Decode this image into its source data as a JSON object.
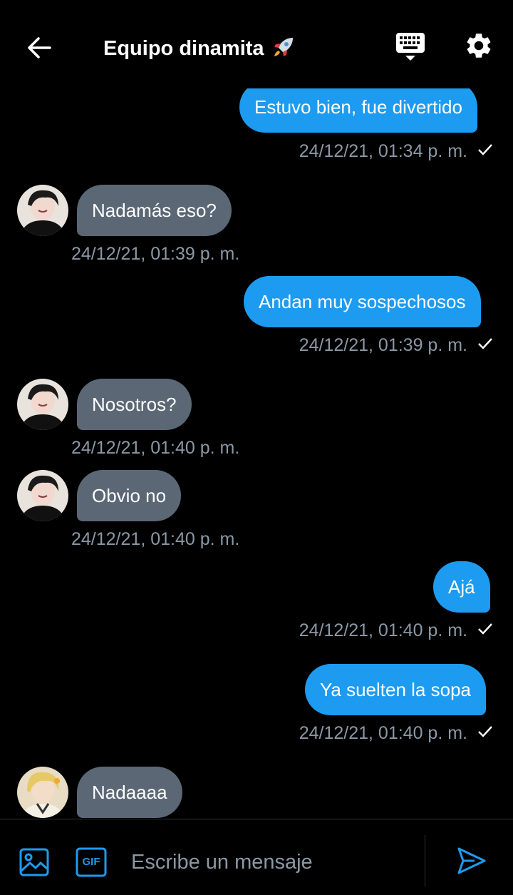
{
  "header": {
    "title": "Equipo dinamita",
    "title_emoji_icon": "rocket-icon",
    "back_icon": "arrow-left-icon",
    "keyboard_icon": "keyboard-icon",
    "settings_icon": "gear-icon"
  },
  "messages": [
    {
      "direction": "out",
      "text": "Estuvo bien, fue divertido",
      "time": "24/12/21, 01:34 p. m.",
      "read": true
    },
    {
      "direction": "in",
      "text": "Nadamás eso?",
      "time": "24/12/21, 01:39 p. m.",
      "avatar": "avatar-dark-hair"
    },
    {
      "direction": "out",
      "text": "Andan muy sospechosos",
      "time": "24/12/21, 01:39 p. m.",
      "read": true
    },
    {
      "direction": "in",
      "text": "Nosotros?",
      "time": "24/12/21, 01:40 p. m.",
      "avatar": "avatar-dark-hair"
    },
    {
      "direction": "in",
      "text": "Obvio no",
      "time": "24/12/21, 01:40 p. m.",
      "avatar": "avatar-dark-hair"
    },
    {
      "direction": "out",
      "text": "Ajá",
      "time": "24/12/21, 01:40 p. m.",
      "read": true
    },
    {
      "direction": "out",
      "text": "Ya suelten la sopa",
      "time": "24/12/21, 01:40 p. m.",
      "read": true
    },
    {
      "direction": "in",
      "text": "Nadaaaa",
      "avatar": "avatar-blonde-hair"
    }
  ],
  "composer": {
    "placeholder": "Escribe un mensaje",
    "image_icon": "image-icon",
    "gif_label": "GIF",
    "send_icon": "send-icon"
  },
  "colors": {
    "background": "#000000",
    "outgoing_bubble": "#1d9bf0",
    "incoming_bubble": "#5b6775",
    "timestamp": "#8b98a5",
    "accent": "#1d9bf0"
  }
}
